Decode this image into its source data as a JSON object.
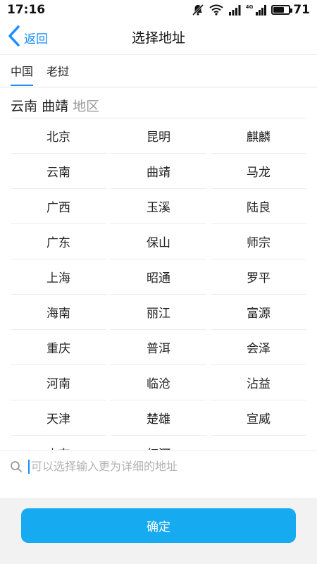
{
  "status_bar": {
    "time": "17:16",
    "network": "4G",
    "battery": "71",
    "battery_level": 0.71,
    "icons": [
      "bell-muted-icon",
      "wifi-icon",
      "signal-icon",
      "signal-4g-icon",
      "battery-icon"
    ]
  },
  "nav": {
    "back_label": "返回",
    "title": "选择地址",
    "accent_color": "#1a8cff"
  },
  "tabs": [
    {
      "label": "中国",
      "active": true
    },
    {
      "label": "老挝",
      "active": false
    }
  ],
  "breadcrumb": {
    "province": "云南",
    "city": "曲靖",
    "hint": "地区"
  },
  "regions": [
    "北京",
    "昆明",
    "麒麟",
    "云南",
    "曲靖",
    "马龙",
    "广西",
    "玉溪",
    "陆良",
    "广东",
    "保山",
    "师宗",
    "上海",
    "昭通",
    "罗平",
    "海南",
    "丽江",
    "富源",
    "重庆",
    "普洱",
    "会泽",
    "河南",
    "临沧",
    "沾益",
    "天津",
    "楚雄",
    "宣威",
    "山东",
    "红河",
    ""
  ],
  "search": {
    "placeholder": "可以选择输入更为详细的地址",
    "value": ""
  },
  "footer": {
    "confirm_label": "确定",
    "button_color": "#16aaf0"
  }
}
